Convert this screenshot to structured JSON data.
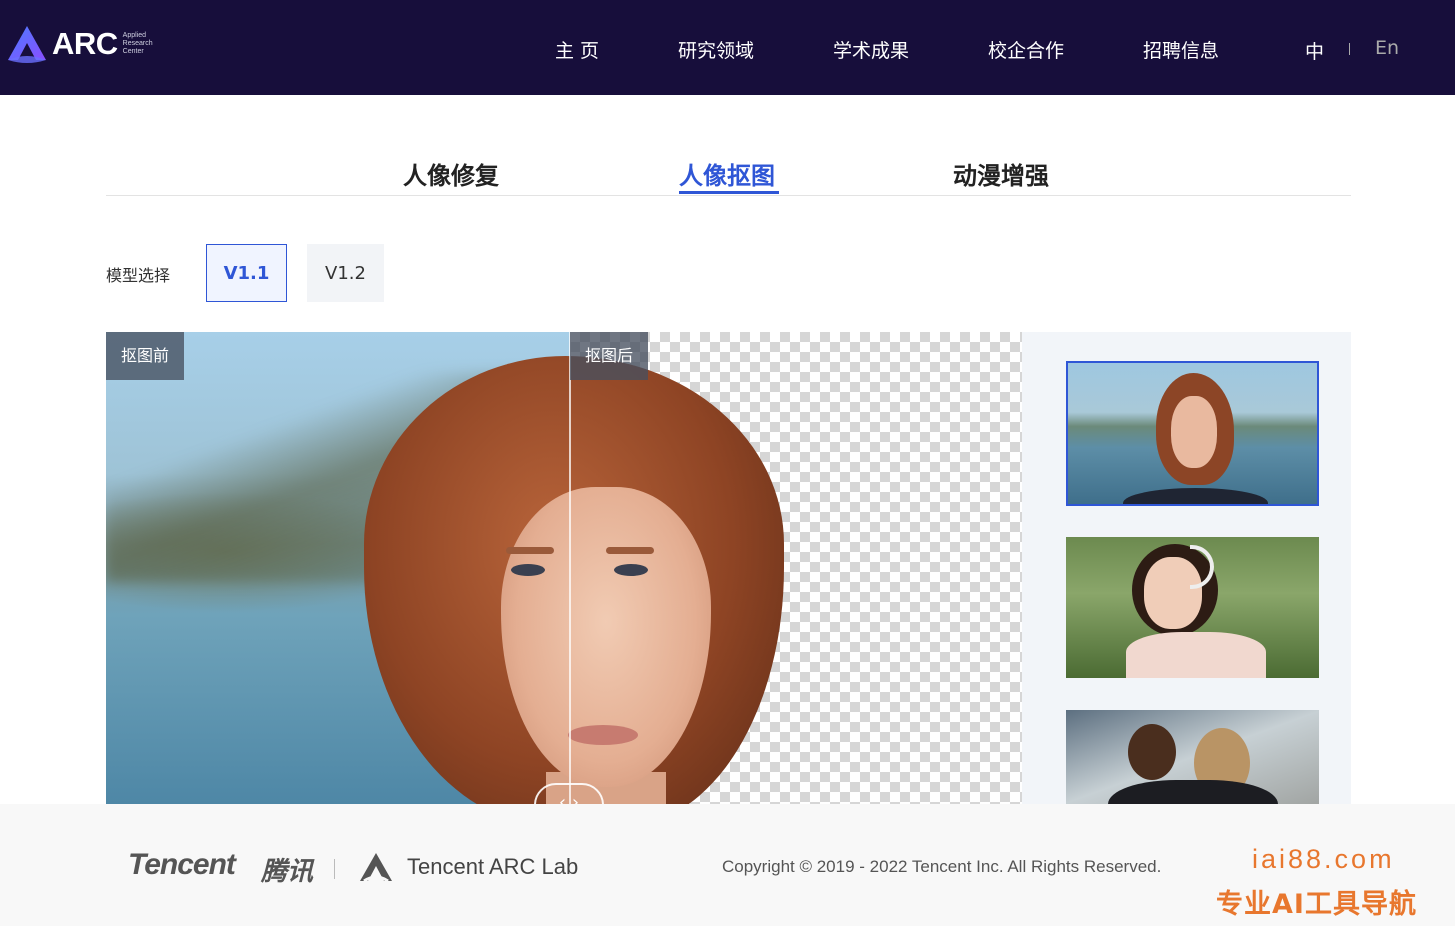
{
  "header": {
    "logo_text": "ARC",
    "logo_sub": [
      "Applied",
      "Research",
      "Center"
    ],
    "nav": [
      "主 页",
      "研究领域",
      "学术成果",
      "校企合作",
      "招聘信息"
    ],
    "lang_zh": "中",
    "lang_en": "En"
  },
  "tabs": [
    "人像修复",
    "人像抠图",
    "动漫增强"
  ],
  "active_tab": "人像抠图",
  "model_select": {
    "label": "模型选择",
    "options": [
      "V1.1",
      "V1.2"
    ],
    "selected": "V1.1"
  },
  "compare": {
    "before_label": "抠图前",
    "after_label": "抠图后",
    "handle_left": "‹",
    "handle_right": "›",
    "split_fraction": 0.507
  },
  "samples": {
    "selected_index": 0,
    "count_visible": 3
  },
  "footer": {
    "tencent": "Tencent",
    "tencent_cn": "腾讯",
    "arc_lab": "Tencent  ARC Lab",
    "copyright": "Copyright © 2019 - 2022 Tencent Inc. All Rights Reserved."
  },
  "watermark": {
    "line1": "iai88.com",
    "line2": "专业AI工具导航"
  },
  "colors": {
    "header_bg": "#170e3b",
    "accent": "#2f56d6",
    "watermark": "#e8772e"
  }
}
